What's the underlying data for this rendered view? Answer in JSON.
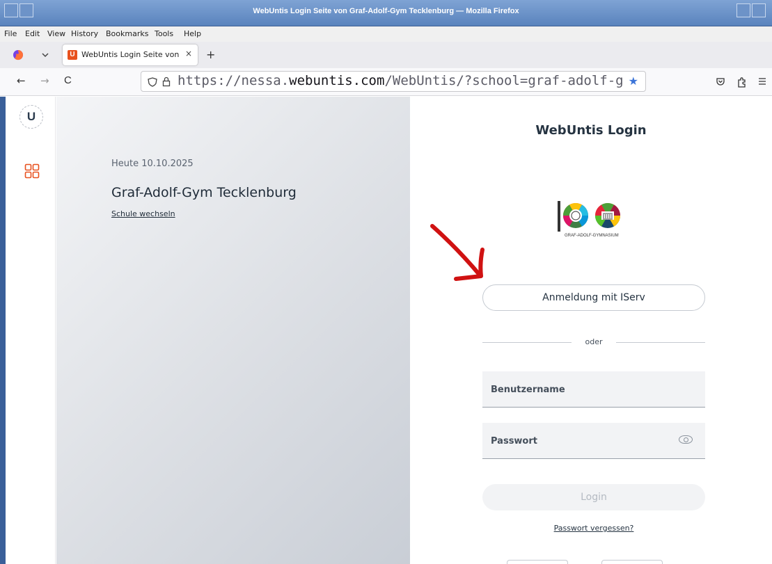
{
  "window": {
    "title": "WebUntis Login Seite von Graf-Adolf-Gym Tecklenburg — Mozilla Firefox"
  },
  "menu": {
    "file": "File",
    "edit": "Edit",
    "view": "View",
    "history": "History",
    "bookmarks": "Bookmarks",
    "tools": "Tools",
    "help": "Help"
  },
  "tab": {
    "title": "WebUntis Login Seite von (",
    "close": "×",
    "favicon_letter": "U",
    "new_tab": "+"
  },
  "nav": {
    "back": "←",
    "forward": "→",
    "reload": "C",
    "url_prefix": "https://nessa.",
    "url_domain": "webuntis.com",
    "url_path": "/WebUntis/?school=graf-adolf-gy",
    "bookmark_star": "★"
  },
  "rail": {
    "logo_letter": "U"
  },
  "info": {
    "date": "Heute 10.10.2025",
    "school": "Graf-Adolf-Gym Tecklenburg",
    "switch_school": "Schule wechseln"
  },
  "login": {
    "title": "WebUntis Login",
    "school_logo_caption": "GRAF-ADOLF-GYMNASIUM",
    "iserv_button": "Anmeldung mit IServ",
    "divider": "oder",
    "username_placeholder": "Benutzername",
    "password_placeholder": "Passwort",
    "login_button": "Login",
    "forgot_password": "Passwort vergessen?"
  },
  "colors": {
    "accent_orange": "#e8511e",
    "annotation_red": "#d01212",
    "text_dark": "#253341",
    "titlebar_blue": "#5a83bd"
  }
}
